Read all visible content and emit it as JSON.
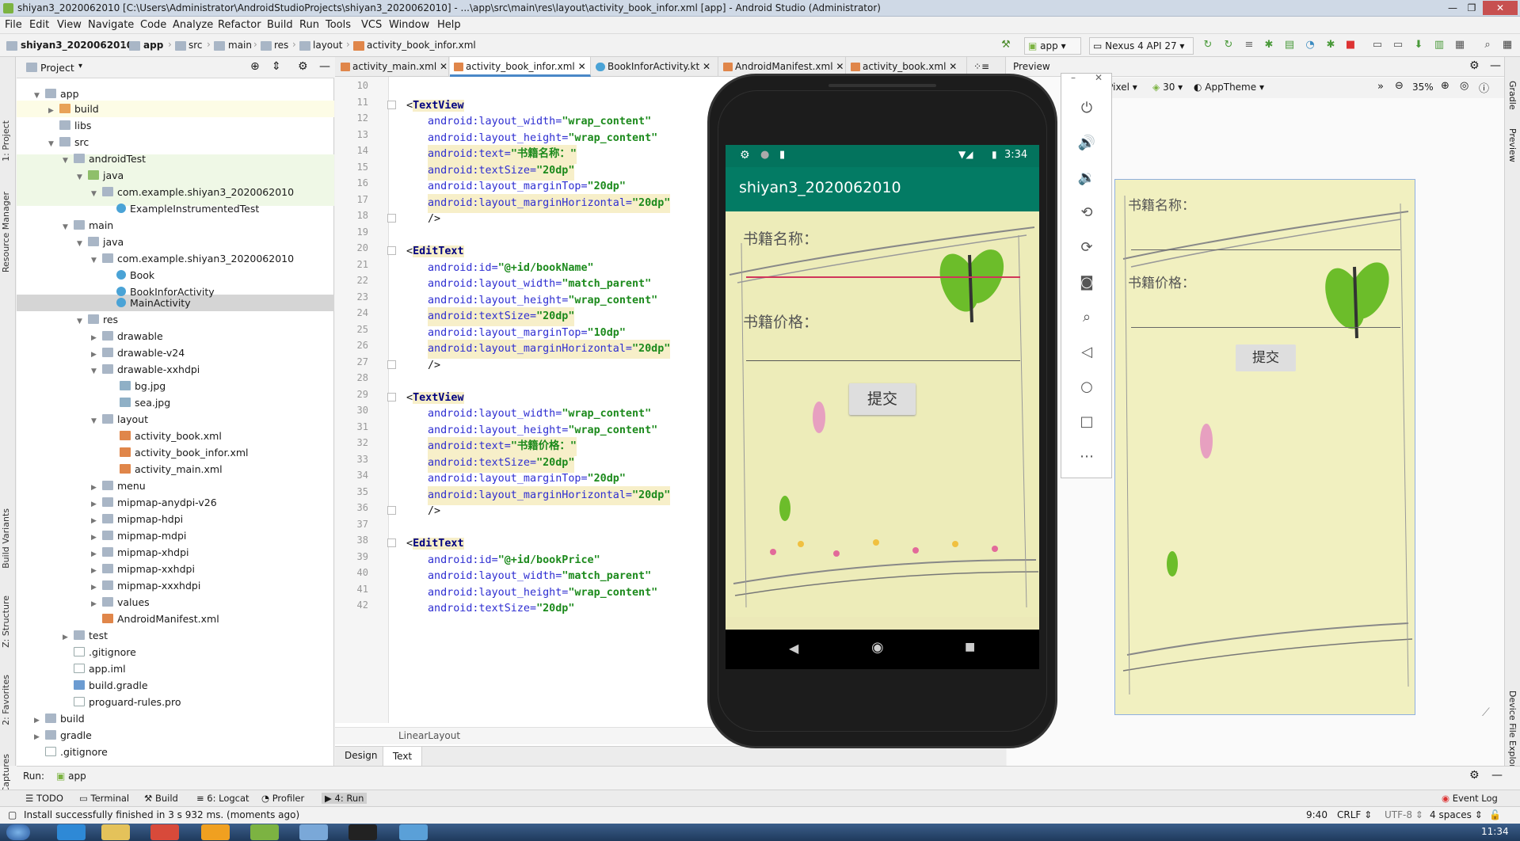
{
  "window": {
    "title": "shiyan3_2020062010 [C:\\Users\\Administrator\\AndroidStudioProjects\\shiyan3_2020062010] - ...\\app\\src\\main\\res\\layout\\activity_book_infor.xml [app] - Android Studio (Administrator)"
  },
  "menu": [
    "File",
    "Edit",
    "View",
    "Navigate",
    "Code",
    "Analyze",
    "Refactor",
    "Build",
    "Run",
    "Tools",
    "VCS",
    "Window",
    "Help"
  ],
  "breadcrumb": [
    "shiyan3_2020062010",
    "app",
    "src",
    "main",
    "res",
    "layout",
    "activity_book_infor.xml"
  ],
  "toolbar": {
    "config": "app",
    "device": "Nexus 4 API 27"
  },
  "project": {
    "header": "Project",
    "tree": [
      "app",
      "build",
      "libs",
      "src",
      "androidTest",
      "java",
      "com.example.shiyan3_2020062010",
      "ExampleInstrumentedTest",
      "main",
      "java",
      "com.example.shiyan3_2020062010",
      "Book",
      "BookInforActivity",
      "MainActivity",
      "res",
      "drawable",
      "drawable-v24",
      "drawable-xxhdpi",
      "bg.jpg",
      "sea.jpg",
      "layout",
      "activity_book.xml",
      "activity_book_infor.xml",
      "activity_main.xml",
      "menu",
      "mipmap-anydpi-v26",
      "mipmap-hdpi",
      "mipmap-mdpi",
      "mipmap-xhdpi",
      "mipmap-xxhdpi",
      "mipmap-xxxhdpi",
      "values",
      "AndroidManifest.xml",
      "test",
      ".gitignore",
      "app.iml",
      "build.gradle",
      "proguard-rules.pro",
      "build",
      "gradle",
      ".gitignore"
    ]
  },
  "tabs": [
    "activity_main.xml",
    "activity_book_infor.xml",
    "BookInforActivity.kt",
    "AndroidManifest.xml",
    "activity_book.xml"
  ],
  "code": {
    "lines": [
      "10",
      "11",
      "12",
      "13",
      "14",
      "15",
      "16",
      "17",
      "18",
      "19",
      "20",
      "21",
      "22",
      "23",
      "24",
      "25",
      "26",
      "27",
      "28",
      "29",
      "30",
      "31",
      "32",
      "33",
      "34",
      "35",
      "36",
      "37",
      "38",
      "39",
      "40",
      "41",
      "42"
    ],
    "rows": [
      {
        "a": "",
        "b": "",
        "c": ""
      },
      {
        "a": "<",
        "b": "TextView",
        "c": ""
      },
      {
        "a": "android:layout_width=",
        "b": "\"wrap_content\"",
        "c": ""
      },
      {
        "a": "android:layout_height=",
        "b": "\"wrap_content\"",
        "c": ""
      },
      {
        "a": "android:text=",
        "b": "\"书籍名称：\"",
        "c": ""
      },
      {
        "a": "android:textSize=",
        "b": "\"20dp\"",
        "c": ""
      },
      {
        "a": "android:layout_marginTop=",
        "b": "\"20dp\"",
        "c": ""
      },
      {
        "a": "android:layout_marginHorizontal=",
        "b": "\"20dp\"",
        "c": ""
      },
      {
        "a": "/>",
        "b": "",
        "c": ""
      },
      {
        "a": "",
        "b": "",
        "c": ""
      },
      {
        "a": "<",
        "b": "EditText",
        "c": ""
      },
      {
        "a": "android:id=",
        "b": "\"@+id/bookName\"",
        "c": ""
      },
      {
        "a": "android:layout_width=",
        "b": "\"match_parent\"",
        "c": ""
      },
      {
        "a": "android:layout_height=",
        "b": "\"wrap_content\"",
        "c": ""
      },
      {
        "a": "android:textSize=",
        "b": "\"20dp\"",
        "c": ""
      },
      {
        "a": "android:layout_marginTop=",
        "b": "\"10dp\"",
        "c": ""
      },
      {
        "a": "android:layout_marginHorizontal=",
        "b": "\"20dp\"",
        "c": ""
      },
      {
        "a": "/>",
        "b": "",
        "c": ""
      },
      {
        "a": "",
        "b": "",
        "c": ""
      },
      {
        "a": "<",
        "b": "TextView",
        "c": ""
      },
      {
        "a": "android:layout_width=",
        "b": "\"wrap_content\"",
        "c": ""
      },
      {
        "a": "android:layout_height=",
        "b": "\"wrap_content\"",
        "c": ""
      },
      {
        "a": "android:text=",
        "b": "\"书籍价格：\"",
        "c": ""
      },
      {
        "a": "android:textSize=",
        "b": "\"20dp\"",
        "c": ""
      },
      {
        "a": "android:layout_marginTop=",
        "b": "\"20dp\"",
        "c": ""
      },
      {
        "a": "android:layout_marginHorizontal=",
        "b": "\"20dp\"",
        "c": ""
      },
      {
        "a": "/>",
        "b": "",
        "c": ""
      },
      {
        "a": "",
        "b": "",
        "c": ""
      },
      {
        "a": "<",
        "b": "EditText",
        "c": ""
      },
      {
        "a": "android:id=",
        "b": "\"@+id/bookPrice\"",
        "c": ""
      },
      {
        "a": "android:layout_width=",
        "b": "\"match_parent\"",
        "c": ""
      },
      {
        "a": "android:layout_height=",
        "b": "\"wrap_content\"",
        "c": ""
      },
      {
        "a": "android:textSize=",
        "b": "\"20dp\"",
        "c": ""
      }
    ],
    "footer": "LinearLayout",
    "design_tab": "Design",
    "text_tab": "Text"
  },
  "preview": {
    "title": "Preview",
    "pixel": "Pixel",
    "api": "30",
    "theme": "AppTheme",
    "zoom": "35%",
    "label1": "书籍名称：",
    "label2": "书籍价格：",
    "button": "提交"
  },
  "phone": {
    "time": "3:34",
    "app_title": "shiyan3_2020062010",
    "label1": "书籍名称：",
    "label2": "书籍价格：",
    "button": "提交"
  },
  "run": {
    "label": "Run:",
    "config": "app"
  },
  "bottom_tabs": [
    "TODO",
    "Terminal",
    "Build",
    "6: Logcat",
    "Profiler",
    "4: Run"
  ],
  "event_log": "Event Log",
  "status": {
    "message": "Install successfully finished in 3 s 932 ms. (moments ago)",
    "pos": "9:40",
    "crlf": "CRLF",
    "enc": "UTF-8",
    "indent": "4 spaces"
  },
  "clock": "11:34",
  "side_tabs": {
    "left": [
      "1: Project",
      "Resource Manager",
      "Build Variants",
      "Z: Structure",
      "2: Favorites",
      "Layout Captures"
    ],
    "right": [
      "Gradle",
      "Preview",
      "Device File Explorer"
    ]
  }
}
